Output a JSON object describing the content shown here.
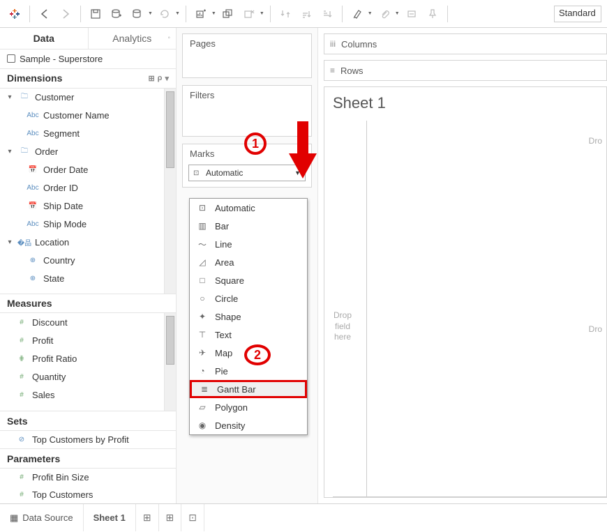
{
  "toolbar": {
    "style_value": "Standard"
  },
  "tabs": {
    "data": "Data",
    "analytics": "Analytics"
  },
  "datasource": "Sample - Superstore",
  "sections": {
    "dimensions": "Dimensions",
    "measures": "Measures",
    "sets": "Sets",
    "parameters": "Parameters"
  },
  "dims": {
    "customer": "Customer",
    "customer_name": "Customer Name",
    "segment": "Segment",
    "order": "Order",
    "order_date": "Order Date",
    "order_id": "Order ID",
    "ship_date": "Ship Date",
    "ship_mode": "Ship Mode",
    "location": "Location",
    "country": "Country",
    "state": "State"
  },
  "measures": {
    "discount": "Discount",
    "profit": "Profit",
    "profit_ratio": "Profit Ratio",
    "quantity": "Quantity",
    "sales": "Sales"
  },
  "sets": {
    "top_customers": "Top Customers by Profit"
  },
  "params": {
    "bin": "Profit Bin Size",
    "topc": "Top Customers"
  },
  "cards": {
    "pages": "Pages",
    "filters": "Filters",
    "marks": "Marks"
  },
  "mark_current": "Automatic",
  "mark_types": {
    "automatic": "Automatic",
    "bar": "Bar",
    "line": "Line",
    "area": "Area",
    "square": "Square",
    "circle": "Circle",
    "shape": "Shape",
    "text": "Text",
    "map": "Map",
    "pie": "Pie",
    "gantt": "Gantt Bar",
    "polygon": "Polygon",
    "density": "Density"
  },
  "shelves": {
    "columns": "Columns",
    "rows": "Rows"
  },
  "viz": {
    "title": "Sheet 1",
    "drop_field": "Drop\nfield\nhere",
    "drop_r": "Dro"
  },
  "bottom": {
    "datasource": "Data Source",
    "sheet1": "Sheet 1"
  },
  "annot": {
    "n1": "1",
    "n2": "2"
  }
}
